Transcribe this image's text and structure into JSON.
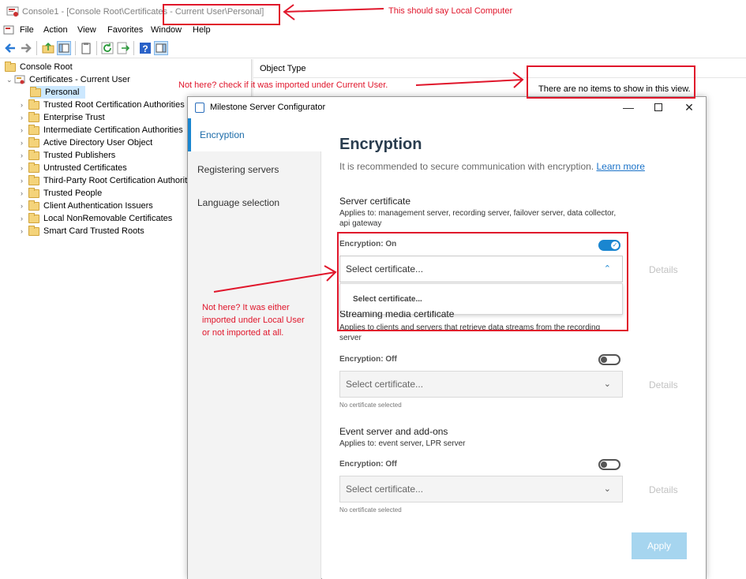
{
  "mmc": {
    "title_prefix": "Console1 - [Console Root\\Certificates - ",
    "title_path": "Current User\\Personal]",
    "menu": [
      "File",
      "Action",
      "View",
      "Favorites",
      "Window",
      "Help"
    ],
    "tree": {
      "root": "Console Root",
      "store": "Certificates - Current User",
      "selected": "Personal",
      "folders": [
        "Trusted Root Certification Authorities",
        "Enterprise Trust",
        "Intermediate Certification Authorities",
        "Active Directory User Object",
        "Trusted Publishers",
        "Untrusted Certificates",
        "Third-Party Root Certification Authoriti",
        "Trusted People",
        "Client Authentication Issuers",
        "Local NonRemovable Certificates",
        "Smart Card Trusted Roots"
      ]
    },
    "list": {
      "column": "Object Type",
      "empty_message": "There are no items to show in this view."
    }
  },
  "dialog": {
    "title": "Milestone Server Configurator",
    "nav": [
      "Encryption",
      "Registering servers",
      "Language selection"
    ],
    "heading": "Encryption",
    "intro": "It is recommended to secure communication with encryption.",
    "learn_more": "Learn more",
    "server_certificate": {
      "title": "Server certificate",
      "subtitle": "Applies to: management server, recording server, failover server, data collector, api gateway",
      "encryption_label": "Encryption: On",
      "select_value": "Select certificate...",
      "dropdown_option": "Select certificate...",
      "details": "Details"
    },
    "streaming": {
      "title": "Streaming media certificate",
      "subtitle": "Applies to clients and servers that retrieve data streams from the recording server",
      "encryption_label": "Encryption: Off",
      "select_value": "Select certificate...",
      "status": "No certificate selected",
      "details": "Details"
    },
    "event_server": {
      "title": "Event server and add-ons",
      "subtitle": "Applies to: event server, LPR server",
      "encryption_label": "Encryption: Off",
      "select_value": "Select certificate...",
      "status": "No certificate selected",
      "details": "Details"
    },
    "apply": "Apply"
  },
  "annotations": {
    "title_note": "This should say Local Computer",
    "list_note": "Not here? check if it was imported under Current User.",
    "dialog_note": "Not here? It was either imported under Local User or not imported at all.",
    "color": "#e0162b"
  }
}
